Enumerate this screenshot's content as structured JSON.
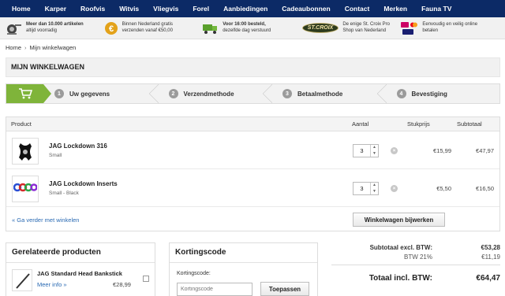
{
  "nav": [
    "Home",
    "Karper",
    "Roofvis",
    "Witvis",
    "Vliegvis",
    "Forel",
    "Aanbiedingen",
    "Cadeaubonnen",
    "Contact",
    "Merken",
    "Fauna TV"
  ],
  "usp": [
    {
      "icon": "fishing-reel-icon",
      "line1": "Meer dan 10.000 artikelen",
      "line2": "altijd voorradig"
    },
    {
      "icon": "euro-coin-icon",
      "line1": "Binnen Nederland gratis",
      "line2": "verzenden vanaf €50,00"
    },
    {
      "icon": "delivery-truck-icon",
      "line1": "Voor 16:00 besteld,",
      "line2": "dezelfde dag verstuurd"
    },
    {
      "icon": "st-croix-logo",
      "logo_text": "ST.CROIX",
      "line1": "De enige St. Croix Pro",
      "line2": "Shop van Nederland"
    },
    {
      "icon": "payment-methods-icon",
      "line1": "Eenvoudig en veilig online",
      "line2": "betalen"
    }
  ],
  "breadcrumb": {
    "home": "Home",
    "separator": "›",
    "current": "Mijn winkelwagen"
  },
  "page_title": "MIJN WINKELWAGEN",
  "steps": [
    {
      "num": "1",
      "label": "Uw gegevens"
    },
    {
      "num": "2",
      "label": "Verzendmethode"
    },
    {
      "num": "3",
      "label": "Betaalmethode"
    },
    {
      "num": "4",
      "label": "Bevestiging"
    }
  ],
  "cart": {
    "headers": {
      "product": "Product",
      "qty": "Aantal",
      "unit": "Stukprijs",
      "subtotal": "Subtotaal"
    },
    "items": [
      {
        "name": "JAG Lockdown 316",
        "variant": "Small",
        "qty": "3",
        "unit_price": "€15,99",
        "subtotal": "€47,97"
      },
      {
        "name": "JAG Lockdown Inserts",
        "variant": "Small - Black",
        "qty": "3",
        "unit_price": "€5,50",
        "subtotal": "€16,50"
      }
    ],
    "continue_link": "« Ga verder met winkelen",
    "update_button": "Winkelwagen bijwerken"
  },
  "related": {
    "title": "Gerelateerde producten",
    "item": {
      "name": "JAG Standard Head Bankstick",
      "more": "Meer info »",
      "price": "€28,99"
    }
  },
  "coupon": {
    "title": "Kortingscode",
    "label": "Kortingscode:",
    "placeholder": "Kortingscode",
    "button": "Toepassen"
  },
  "totals": {
    "subtotal_label": "Subtotaal excl. BTW:",
    "subtotal": "€53,28",
    "btw_label": "BTW 21%",
    "btw": "€11,19",
    "total_label": "Totaal incl. BTW:",
    "total": "€64,47"
  },
  "colors": {
    "nav_bg": "#0c2a66",
    "step_active": "#7fb43a",
    "link": "#2a6ab3"
  }
}
